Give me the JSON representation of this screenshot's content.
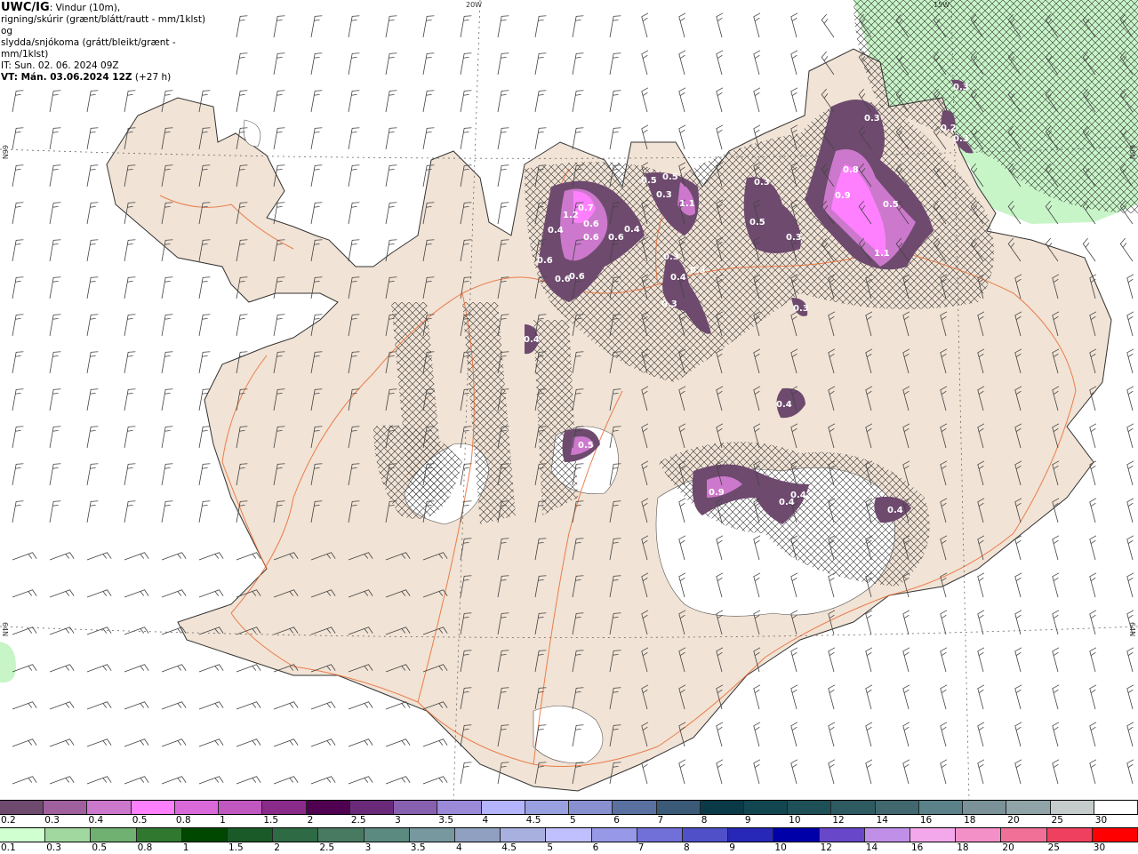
{
  "title": {
    "model": "UWC/IG",
    "line1": ": Vindur (10m),",
    "line2": "rigning/skúrir (grænt/blátt/rautt - mm/1klst) og",
    "line3": "slydda/snjókoma (grátt/bleikt/grænt - mm/1klst)",
    "init_time": "IT: Sun. 02. 06. 2024 09Z",
    "valid_label": "VT: Mán. 03.06.2024 12Z",
    "lead": " (+27 h)"
  },
  "axes": {
    "lon_20w": "20W",
    "lon_15w": "15W",
    "lat_66n_left": "66N",
    "lat_66n_right": "66N",
    "lat_64n_left": "64N",
    "lat_64n_right": "64N"
  },
  "colors": {
    "land": "#f1e3d5",
    "sea": "#ffffff",
    "glacier": "#ffffff",
    "rain_green": "#c8f5c8",
    "roads": "#e8642a",
    "coast": "#333333"
  },
  "precip_labels": [
    "0.3",
    "0.3",
    "0.2",
    "0.3",
    "0.8",
    "0.9",
    "0.5",
    "1.1",
    "0.3",
    "0.5",
    "0.3",
    "0.3",
    "0.5",
    "0.5",
    "0.3",
    "1.1",
    "1.2",
    "0.7",
    "0.4",
    "0.6",
    "0.6",
    "0.6",
    "0.4",
    "0.6",
    "0.6",
    "0.6",
    "0.3",
    "0.4",
    "0.3",
    "0.3",
    "0.4",
    "0.4",
    "0.5",
    "0.9",
    "0.4",
    "0.4",
    "0.4"
  ],
  "legend_snow": {
    "labels": [
      "0.2",
      "0.3",
      "0.4",
      "0.5",
      "0.8",
      "1",
      "1.5",
      "2",
      "2.5",
      "3",
      "3.5",
      "4",
      "4.5",
      "5",
      "6",
      "7",
      "8",
      "9",
      "10",
      "12",
      "14",
      "16",
      "18",
      "20",
      "25",
      "30"
    ],
    "colors": [
      "#6e4a6e",
      "#a0609e",
      "#cc78cc",
      "#ff80ff",
      "#da6ada",
      "#c058c0",
      "#8a2a8a",
      "#500050",
      "#6a2a7a",
      "#8860b0",
      "#9a8ad8",
      "#b4b4ff",
      "#98a0e0",
      "#8890d0",
      "#5a70a0",
      "#3a5a78",
      "#0a3a48",
      "#124650",
      "#1e5058",
      "#2e5a62",
      "#40686e",
      "#5a8288",
      "#7a9298",
      "#90a4a8",
      "#c4cccc",
      "#ffffff"
    ]
  },
  "legend_rain": {
    "labels": [
      "0.1",
      "0.3",
      "0.5",
      "0.8",
      "1",
      "1.5",
      "2",
      "2.5",
      "3",
      "3.5",
      "4",
      "4.5",
      "5",
      "6",
      "7",
      "8",
      "9",
      "10",
      "12",
      "14",
      "16",
      "18",
      "20",
      "25",
      "30"
    ],
    "colors": [
      "#d0ffd0",
      "#a0d8a0",
      "#70b070",
      "#307830",
      "#004800",
      "#1a5a28",
      "#2e6a44",
      "#487a62",
      "#5a8a80",
      "#7898a0",
      "#90a0c0",
      "#a8b0e0",
      "#c0c0ff",
      "#9898e8",
      "#7070d8",
      "#5050c8",
      "#2828b8",
      "#0000a8",
      "#6848c8",
      "#c090e8",
      "#f4a8ec",
      "#f490c8",
      "#f07098",
      "#f04060",
      "#ff0000"
    ]
  }
}
